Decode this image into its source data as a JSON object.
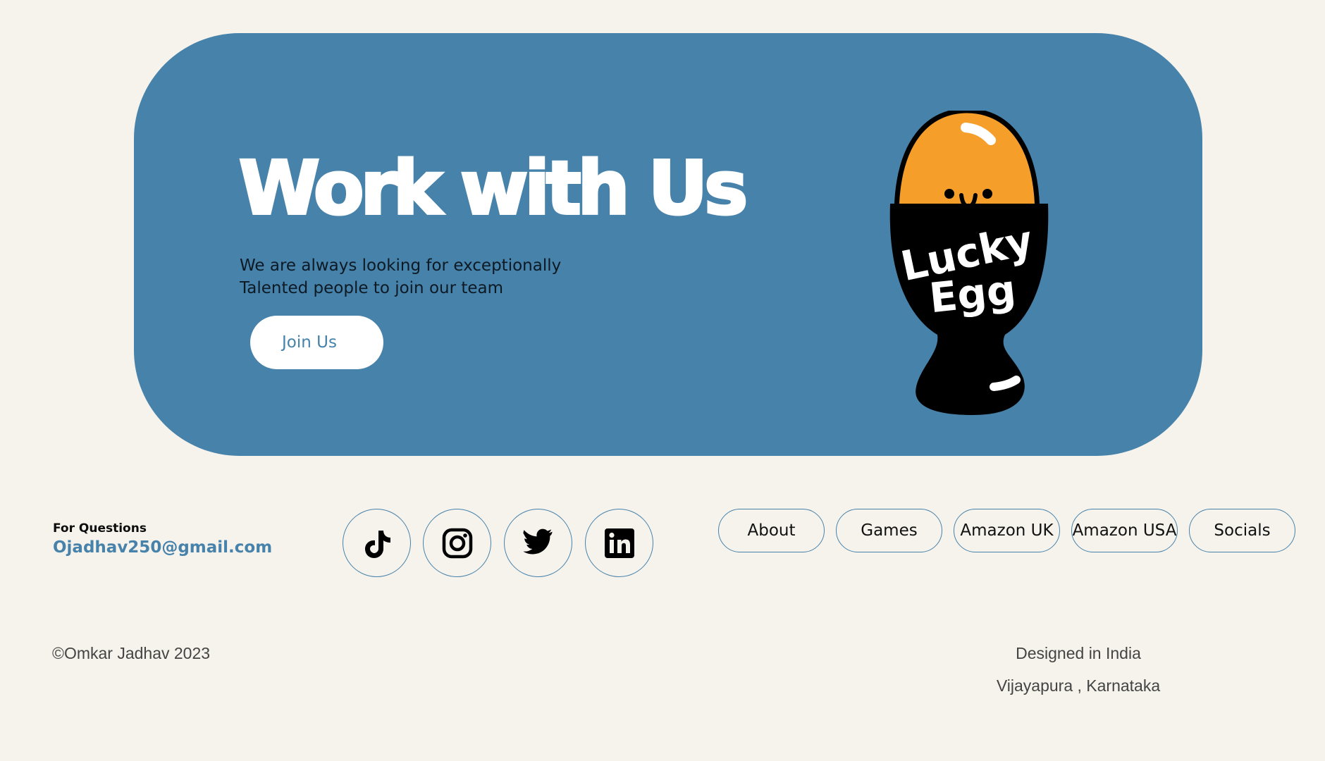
{
  "hero": {
    "title": "Work with Us",
    "description": "We are always looking for exceptionally Talented people to join our team",
    "cta_label": "Join Us",
    "illustration_text_line1": "Lucky",
    "illustration_text_line2": "Egg"
  },
  "contact": {
    "label": "For Questions",
    "email": "Ojadhav250@gmail.com"
  },
  "social": [
    {
      "name": "tiktok-icon"
    },
    {
      "name": "instagram-icon"
    },
    {
      "name": "twitter-icon"
    },
    {
      "name": "linkedin-icon"
    }
  ],
  "nav": {
    "items": [
      {
        "label": "About"
      },
      {
        "label": "Games"
      },
      {
        "label": "Amazon UK"
      },
      {
        "label": "Amazon USA"
      },
      {
        "label": "Socials"
      }
    ]
  },
  "footer": {
    "copyright": "©Omkar Jadhav 2023",
    "designed_line1": "Designed in India",
    "designed_line2": "Vijayapura , Karnataka"
  },
  "colors": {
    "background": "#f6f3ec",
    "accent": "#4782ab",
    "egg_yolk": "#f59f2a"
  }
}
